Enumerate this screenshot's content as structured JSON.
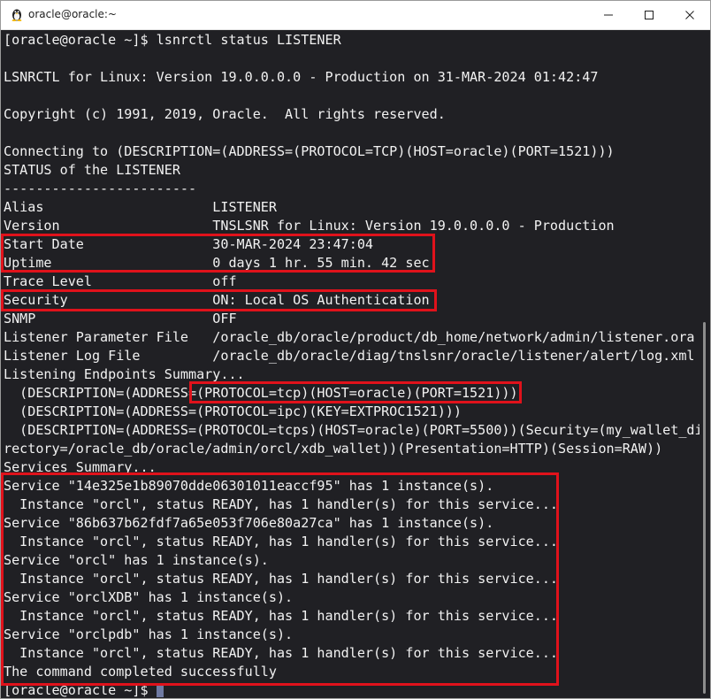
{
  "window": {
    "title": "oracle@oracle:~",
    "controls": [
      "minimize-icon",
      "maximize-icon",
      "close-icon"
    ]
  },
  "terminal": {
    "lines": [
      "[oracle@oracle ~]$ lsnrctl status LISTENER",
      "",
      "LSNRCTL for Linux: Version 19.0.0.0.0 - Production on 31-MAR-2024 01:42:47",
      "",
      "Copyright (c) 1991, 2019, Oracle.  All rights reserved.",
      "",
      "Connecting to (DESCRIPTION=(ADDRESS=(PROTOCOL=TCP)(HOST=oracle)(PORT=1521)))",
      "STATUS of the LISTENER",
      "------------------------",
      "Alias                     LISTENER",
      "Version                   TNSLSNR for Linux: Version 19.0.0.0.0 - Production",
      "Start Date                30-MAR-2024 23:47:04",
      "Uptime                    0 days 1 hr. 55 min. 42 sec",
      "Trace Level               off",
      "Security                  ON: Local OS Authentication",
      "SNMP                      OFF",
      "Listener Parameter File   /oracle_db/oracle/product/db_home/network/admin/listener.ora",
      "Listener Log File         /oracle_db/oracle/diag/tnslsnr/oracle/listener/alert/log.xml",
      "Listening Endpoints Summary...",
      "  (DESCRIPTION=(ADDRESS=(PROTOCOL=tcp)(HOST=oracle)(PORT=1521)))",
      "  (DESCRIPTION=(ADDRESS=(PROTOCOL=ipc)(KEY=EXTPROC1521)))",
      "  (DESCRIPTION=(ADDRESS=(PROTOCOL=tcps)(HOST=oracle)(PORT=5500))(Security=(my_wallet_di",
      "rectory=/oracle_db/oracle/admin/orcl/xdb_wallet))(Presentation=HTTP)(Session=RAW))",
      "Services Summary...",
      "Service \"14e325e1b89070dde06301011eaccf95\" has 1 instance(s).",
      "  Instance \"orcl\", status READY, has 1 handler(s) for this service...",
      "Service \"86b637b62fdf7a65e053f706e80a27ca\" has 1 instance(s).",
      "  Instance \"orcl\", status READY, has 1 handler(s) for this service...",
      "Service \"orcl\" has 1 instance(s).",
      "  Instance \"orcl\", status READY, has 1 handler(s) for this service...",
      "Service \"orclXDB\" has 1 instance(s).",
      "  Instance \"orcl\", status READY, has 1 handler(s) for this service...",
      "Service \"orclpdb\" has 1 instance(s).",
      "  Instance \"orcl\", status READY, has 1 handler(s) for this service...",
      "The command completed successfully"
    ],
    "prompt": "[oracle@oracle ~]$ "
  },
  "colors": {
    "terminal_background": "#202024",
    "terminal_text": "#f2f2f2",
    "highlight": "#e0121b"
  }
}
